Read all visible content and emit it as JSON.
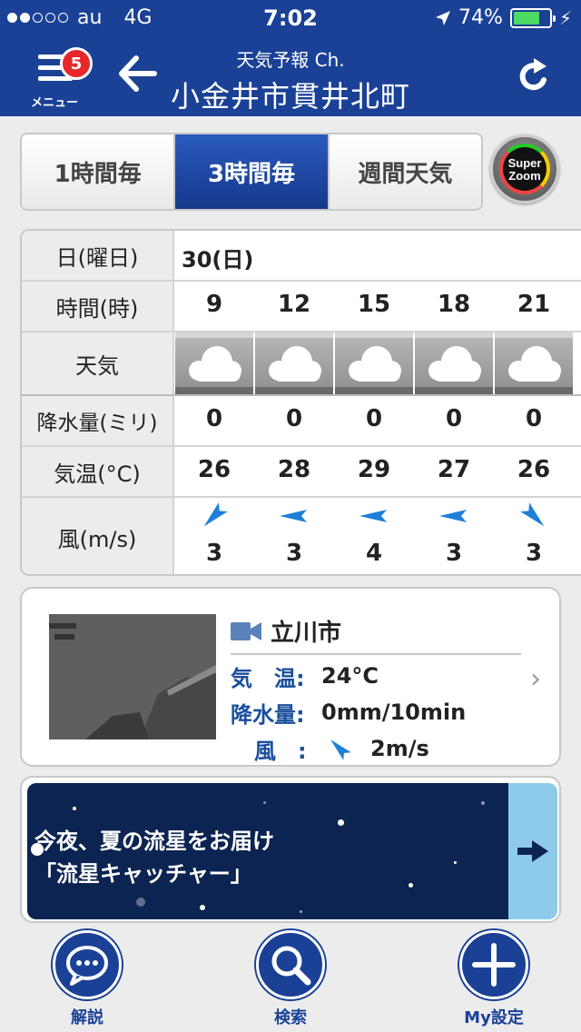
{
  "status_bar": {
    "carrier": "au",
    "network": "4G",
    "time": "7:02",
    "battery": "74%",
    "battery_level": 0.74,
    "signal_bars_filled": 2,
    "signal_bars_total": 5
  },
  "nav": {
    "menu_label": "メニュー",
    "badge_count": "5",
    "subtitle": "天気予報 Ch.",
    "title": "小金井市貫井北町"
  },
  "tabs": [
    {
      "label": "1時間毎",
      "active": false
    },
    {
      "label": "3時間毎",
      "active": true
    },
    {
      "label": "週間天気",
      "active": false
    }
  ],
  "super_zoom": {
    "line1": "Super",
    "line2": "Zoom"
  },
  "forecast": {
    "headers": {
      "date": "日(曜日)",
      "time": "時間(時)",
      "weather": "天気",
      "precip": "降水量(ミリ)",
      "temp": "気温(°C)",
      "wind": "風(m/s)"
    },
    "date": "30(日)",
    "hours": [
      "9",
      "12",
      "15",
      "18",
      "21"
    ],
    "weather": [
      "cloudy-icon",
      "cloudy-icon",
      "cloudy-icon",
      "cloudy-icon",
      "cloudy-icon"
    ],
    "precip": [
      "0",
      "0",
      "0",
      "0",
      "0"
    ],
    "temp": [
      "26",
      "28",
      "29",
      "27",
      "26"
    ],
    "wind_speed": [
      "3",
      "3",
      "4",
      "3",
      "3"
    ],
    "wind_direction": [
      "northeast",
      "east",
      "east",
      "east",
      "northwest"
    ]
  },
  "camera": {
    "city": "立川市",
    "temp_label": "気　温:",
    "temp_value": "24°C",
    "precip_label": "降水量:",
    "precip_value": "0mm/10min",
    "wind_label": "風　:",
    "wind_value": "2m/s",
    "wind_direction": "southwest"
  },
  "banner": {
    "line1": "今夜、夏の流星をお届け",
    "line2": "「流星キャッチャー」"
  },
  "toolbar": {
    "explain": "解説",
    "search": "検索",
    "my_settings": "My設定"
  },
  "colors": {
    "brand": "#1a4196",
    "wind_arrow": "#1e7fd8",
    "battery": "#4cd964",
    "badge": "#e8262b"
  }
}
